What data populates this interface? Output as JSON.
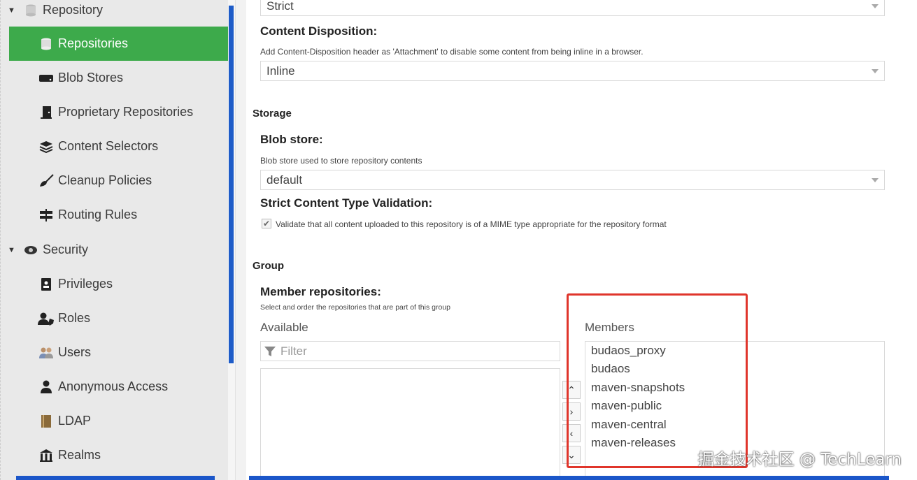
{
  "sidebar": {
    "groups": [
      {
        "label": "Repository",
        "icon": "database-icon"
      },
      {
        "label": "Security",
        "icon": "eye-icon"
      }
    ],
    "items": [
      {
        "label": "Repositories",
        "icon": "database-icon",
        "active": true
      },
      {
        "label": "Blob Stores",
        "icon": "hdd-icon"
      },
      {
        "label": "Proprietary Repositories",
        "icon": "door-icon"
      },
      {
        "label": "Content Selectors",
        "icon": "layers-icon"
      },
      {
        "label": "Cleanup Policies",
        "icon": "broom-icon"
      },
      {
        "label": "Routing Rules",
        "icon": "signpost-icon"
      },
      {
        "label": "Privileges",
        "icon": "id-badge-icon"
      },
      {
        "label": "Roles",
        "icon": "user-shield-icon"
      },
      {
        "label": "Users",
        "icon": "users-icon"
      },
      {
        "label": "Anonymous Access",
        "icon": "user-icon"
      },
      {
        "label": "LDAP",
        "icon": "book-icon"
      },
      {
        "label": "Realms",
        "icon": "building-icon"
      }
    ]
  },
  "form": {
    "top_select_value": "Strict",
    "content_disposition": {
      "label": "Content Disposition:",
      "help": "Add Content-Disposition header as 'Attachment' to disable some content from being inline in a browser.",
      "value": "Inline"
    },
    "storage": {
      "section": "Storage",
      "blob_store_label": "Blob store:",
      "blob_store_help": "Blob store used to store repository contents",
      "blob_store_value": "default",
      "strict_label": "Strict Content Type Validation:",
      "strict_help": "Validate that all content uploaded to this repository is of a MIME type appropriate for the repository format",
      "strict_checked": true
    },
    "group": {
      "section": "Group",
      "members_label": "Member repositories:",
      "members_help": "Select and order the repositories that are part of this group",
      "available_title": "Available",
      "filter_placeholder": "Filter",
      "members_title": "Members",
      "members": [
        "budaos_proxy",
        "budaos",
        "maven-snapshots",
        "maven-public",
        "maven-central",
        "maven-releases"
      ]
    }
  },
  "colors": {
    "active": "#3daa4b",
    "accent": "#1e5cc8",
    "highlight": "#e0352b"
  },
  "watermark": "掘金技术社区 @ TechLearn"
}
